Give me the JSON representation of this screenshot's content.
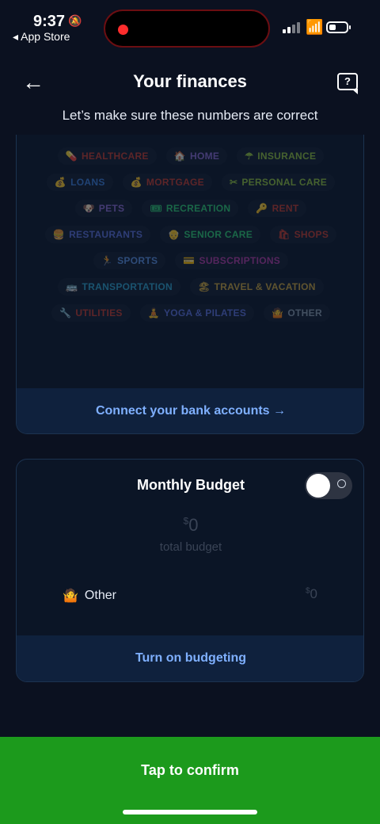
{
  "status": {
    "time": "9:37",
    "back_app": "◂ App Store"
  },
  "header": {
    "title": "Your finances",
    "subtitle": "Let’s make sure these numbers are correct"
  },
  "categories": [
    [
      {
        "label": "HEALTHCARE",
        "color": "#c0392b",
        "icon": "💊"
      },
      {
        "label": "HOME",
        "color": "#8a6ad0",
        "icon": "🏠"
      },
      {
        "label": "INSURANCE",
        "color": "#8fbf3a",
        "icon": "☂"
      }
    ],
    [
      {
        "label": "LOANS",
        "color": "#3a7bd5",
        "icon": "💰"
      },
      {
        "label": "MORTGAGE",
        "color": "#c0392b",
        "icon": "💰"
      },
      {
        "label": "PERSONAL CARE",
        "color": "#8fbf3a",
        "icon": "✂"
      }
    ],
    [
      {
        "label": "PETS",
        "color": "#8a6ad0",
        "icon": "🐶"
      },
      {
        "label": "RECREATION",
        "color": "#2ecc71",
        "icon": "🎟"
      },
      {
        "label": "RENT",
        "color": "#c0392b",
        "icon": "🔑"
      }
    ],
    [
      {
        "label": "RESTAURANTS",
        "color": "#5a6fd8",
        "icon": "🍔"
      },
      {
        "label": "SENIOR CARE",
        "color": "#2ecc71",
        "icon": "👴"
      },
      {
        "label": "SHOPS",
        "color": "#c0392b",
        "icon": "🛍"
      }
    ],
    [
      {
        "label": "SPORTS",
        "color": "#5a8fe0",
        "icon": "🏃"
      },
      {
        "label": "SUBSCRIPTIONS",
        "color": "#b03aa0",
        "icon": "💳"
      }
    ],
    [
      {
        "label": "TRANSPORTATION",
        "color": "#2ea0c8",
        "icon": "🚌"
      },
      {
        "label": "TRAVEL & VACATION",
        "color": "#c8a23a",
        "icon": "🏖"
      }
    ],
    [
      {
        "label": "UTILITIES",
        "color": "#c0392b",
        "icon": "🔧"
      },
      {
        "label": "YOGA & PILATES",
        "color": "#5a6fd8",
        "icon": "🧘"
      },
      {
        "label": "OTHER",
        "color": "#8899aa",
        "icon": "🤷"
      }
    ]
  ],
  "connect_label": "Connect your bank accounts →",
  "budget": {
    "title": "Monthly Budget",
    "toggle_on": false,
    "currency": "$",
    "amount": "0",
    "total_label": "total budget",
    "row_label": "Other",
    "row_currency": "$",
    "row_amount": "0",
    "turn_on_label": "Turn on budgeting"
  },
  "confirm_label": "Tap to confirm"
}
